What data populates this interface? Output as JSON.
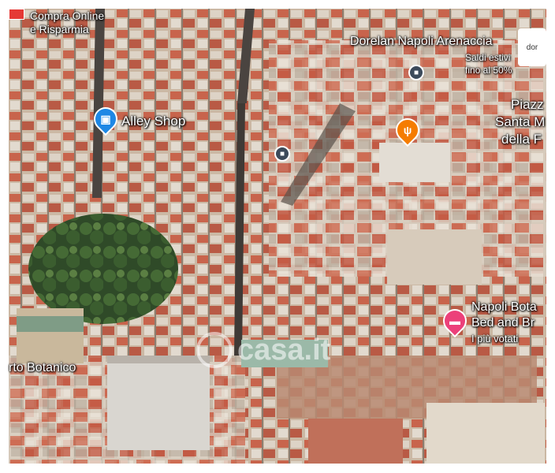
{
  "map": {
    "labels": {
      "compra": [
        "Compra Online",
        "e Risparmia"
      ],
      "dorelan_title": "Dorelan Napoli Arenaccia",
      "dorelan_sub": [
        "Saldi estivi",
        "fino al 50%"
      ],
      "dorelan_badge": "dor",
      "alley": "Alley Shop",
      "piazza": [
        "Piazz",
        "Santa M",
        "della F"
      ],
      "napoli_bot": [
        "Napoli Bota",
        "Bed and Br",
        "I più votati"
      ],
      "orto": "rto Botanico"
    },
    "watermark": "casa.it",
    "colors": {
      "shop_pin": "#1e88e5",
      "food_pin": "#f57c00",
      "hotel_pin": "#ec407a",
      "bus": "#3c4a5a"
    },
    "icons": {
      "shop": "shopping-bag-icon",
      "food": "fork-knife-icon",
      "hotel": "bed-icon",
      "bus": "bus-icon"
    }
  }
}
